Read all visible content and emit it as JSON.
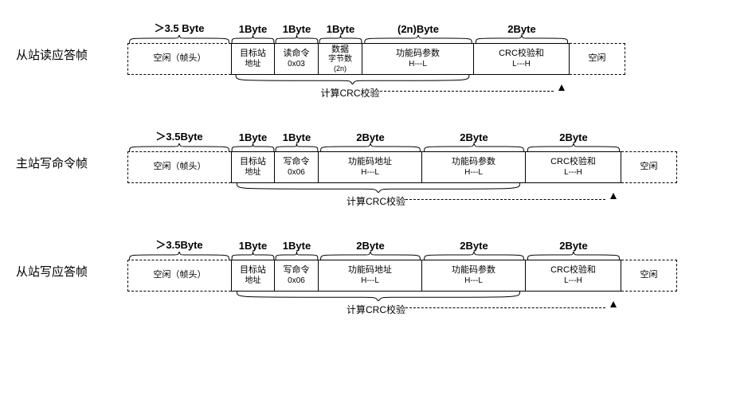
{
  "frames": [
    {
      "label": "从站读应答帧",
      "size_labels": [
        "＞3.5 Byte",
        "1Byte",
        "1Byte",
        "1Byte",
        "(2n)Byte",
        "2Byte",
        ""
      ],
      "widths": [
        130,
        55,
        55,
        55,
        140,
        120,
        70
      ],
      "cells": [
        {
          "l1": "空闲（帧头）",
          "l2": "",
          "dashed": true,
          "dashed_left": true
        },
        {
          "l1": "目标站",
          "l2": "地址"
        },
        {
          "l1": "读命令",
          "l2": "0x03"
        },
        {
          "l1": "数据",
          "l2": "字节数",
          "l3": "(2n)"
        },
        {
          "l1": "功能码参数",
          "l2": "H---L"
        },
        {
          "l1": "CRC校验和",
          "l2": "L---H"
        },
        {
          "l1": "空闲",
          "l2": "",
          "dashed": true
        }
      ],
      "crc_span_start": 1,
      "crc_span_end": 5,
      "crc_label": "计算CRC校验"
    },
    {
      "label": "主站写命令帧",
      "size_labels": [
        "＞3.5Byte",
        "1Byte",
        "1Byte",
        "2Byte",
        "2Byte",
        "2Byte",
        ""
      ],
      "widths": [
        130,
        55,
        55,
        130,
        130,
        120,
        70
      ],
      "cells": [
        {
          "l1": "空闲（帧头）",
          "l2": "",
          "dashed": true,
          "dashed_left": true
        },
        {
          "l1": "目标站",
          "l2": "地址"
        },
        {
          "l1": "写命令",
          "l2": "0x06"
        },
        {
          "l1": "功能码地址",
          "l2": "H---L"
        },
        {
          "l1": "功能码参数",
          "l2": "H---L"
        },
        {
          "l1": "CRC校验和",
          "l2": "L---H"
        },
        {
          "l1": "空闲",
          "l2": "",
          "dashed": true
        }
      ],
      "crc_span_start": 1,
      "crc_span_end": 5,
      "crc_label": "计算CRC校验"
    },
    {
      "label": "从站写应答帧",
      "size_labels": [
        "＞3.5Byte",
        "1Byte",
        "1Byte",
        "2Byte",
        "2Byte",
        "2Byte",
        ""
      ],
      "widths": [
        130,
        55,
        55,
        130,
        130,
        120,
        70
      ],
      "cells": [
        {
          "l1": "空闲（帧头）",
          "l2": "",
          "dashed": true,
          "dashed_left": true
        },
        {
          "l1": "目标站",
          "l2": "地址"
        },
        {
          "l1": "写命令",
          "l2": "0x06"
        },
        {
          "l1": "功能码地址",
          "l2": "H---L"
        },
        {
          "l1": "功能码参数",
          "l2": "H---L"
        },
        {
          "l1": "CRC校验和",
          "l2": "L---H"
        },
        {
          "l1": "空闲",
          "l2": "",
          "dashed": true
        }
      ],
      "crc_span_start": 1,
      "crc_span_end": 5,
      "crc_label": "计算CRC校验"
    }
  ]
}
